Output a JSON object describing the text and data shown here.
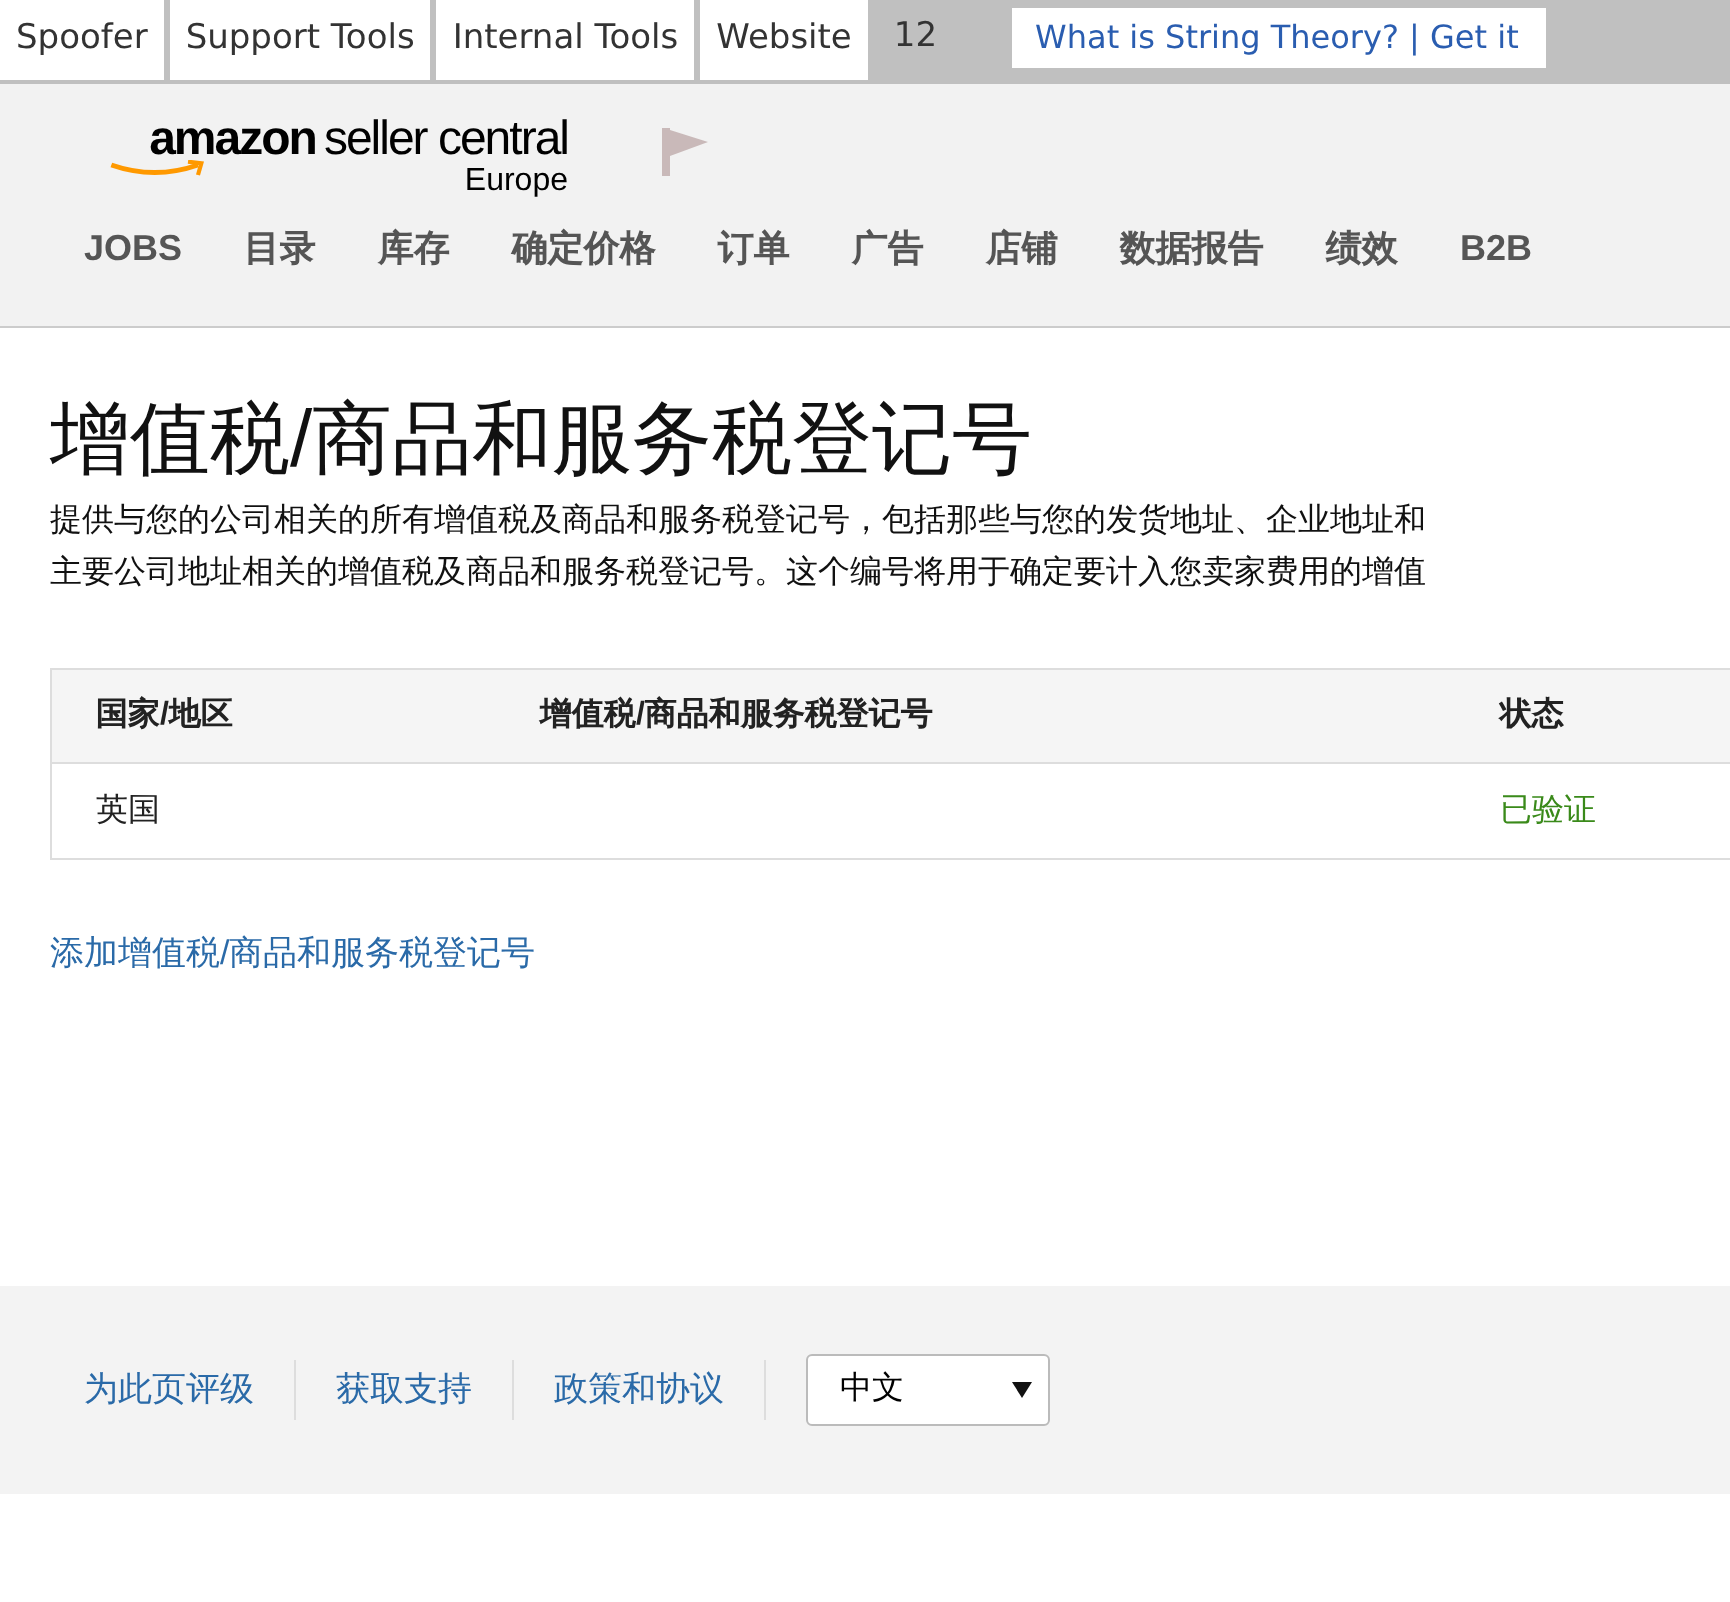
{
  "toolbar": {
    "tabs": [
      {
        "label": "Spoofer"
      },
      {
        "label": "Support Tools"
      },
      {
        "label": "Internal Tools"
      },
      {
        "label": "Website"
      }
    ],
    "count": "12",
    "search": {
      "value": "What is String Theory? | Get it"
    }
  },
  "header": {
    "logo": {
      "brand": "amazon",
      "product": "seller central",
      "region": "Europe"
    },
    "nav": [
      "JOBS",
      "目录",
      "库存",
      "确定价格",
      "订单",
      "广告",
      "店铺",
      "数据报告",
      "绩效",
      "B2B"
    ]
  },
  "page": {
    "title": "增值税/商品和服务税登记号",
    "description": [
      "提供与您的公司相关的所有增值税及商品和服务税登记号，包括那些与您的发货地址、企业地址和",
      "主要公司地址相关的增值税及商品和服务税登记号。这个编号将用于确定要计入您卖家费用的增值"
    ],
    "table": {
      "columns": [
        "国家/地区",
        "增值税/商品和服务税登记号",
        "状态"
      ],
      "rows": [
        {
          "country": "英国",
          "status": "已验证"
        }
      ]
    },
    "add_link": "添加增值税/商品和服务税登记号"
  },
  "footer": {
    "links": [
      "为此页评级",
      "获取支持",
      "政策和协议"
    ],
    "language": {
      "value": "中文"
    }
  }
}
